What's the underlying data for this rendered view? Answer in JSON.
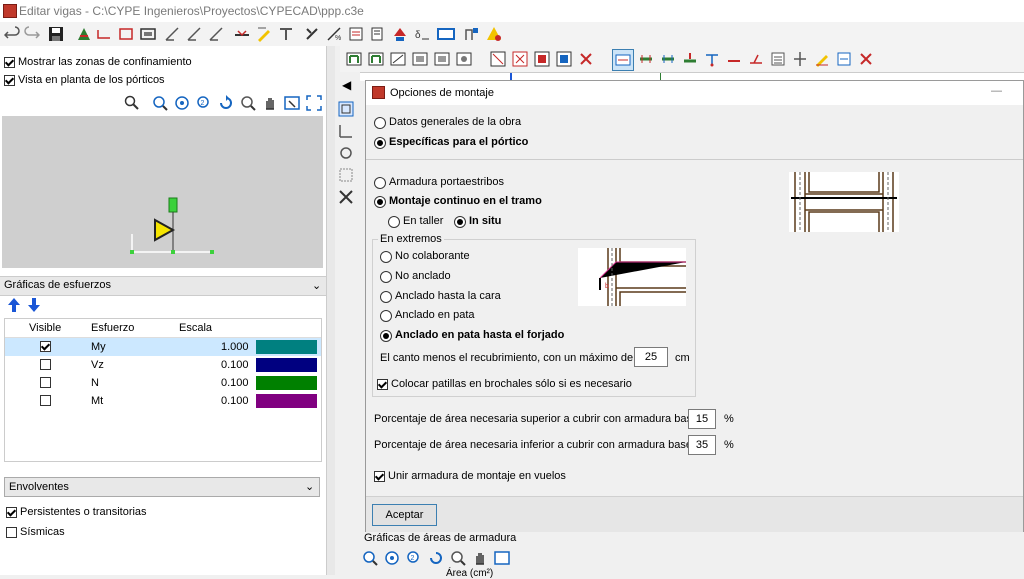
{
  "window": {
    "title": "Editar vigas - C:\\CYPE Ingenieros\\Proyectos\\CYPECAD\\ppp.c3e"
  },
  "left": {
    "show_confinement": {
      "label": "Mostrar las zonas de confinamiento",
      "checked": true
    },
    "plan_view": {
      "label": "Vista en planta de los pórticos",
      "checked": true
    },
    "graphs_header": "Gráficas de esfuerzos",
    "table": {
      "columns": [
        "Visible",
        "Esfuerzo",
        "Escala"
      ],
      "rows": [
        {
          "visible": true,
          "name": "My",
          "scale": "1.000",
          "color": "#008080"
        },
        {
          "visible": false,
          "name": "Vz",
          "scale": "0.100",
          "color": "#000080"
        },
        {
          "visible": false,
          "name": "N",
          "scale": "0.100",
          "color": "#008000"
        },
        {
          "visible": false,
          "name": "Mt",
          "scale": "0.100",
          "color": "#800080"
        }
      ]
    },
    "envelope_select": "Envolventes",
    "persistent": {
      "label": "Persistentes o transitorias",
      "checked": true
    },
    "seismic": {
      "label": "Sísmicas",
      "checked": false
    }
  },
  "dialog": {
    "title": "Opciones de montaje",
    "scope": {
      "general": "Datos generales de la obra",
      "specific": "Específicas para el pórtico",
      "selected": "specific"
    },
    "armature": {
      "option1": "Armadura portaestribos",
      "option2": "Montaje continuo en el tramo",
      "selected": "option2",
      "sub_taller": "En taller",
      "sub_situ": "In situ",
      "sub_selected": "situ"
    },
    "extremes": {
      "group_label": "En extremos",
      "options": [
        "No colaborante",
        "No anclado",
        "Anclado hasta la cara",
        "Anclado en pata",
        "Anclado en pata hasta el forjado"
      ],
      "selected_index": 4,
      "canto_label": "El canto menos el recubrimiento, con un máximo de",
      "canto_value": "25",
      "canto_unit": "cm",
      "patillas_label": "Colocar patillas en brochales sólo si es necesario",
      "patillas_checked": true
    },
    "sup_label": "Porcentaje de área necesaria superior a cubrir con armadura base",
    "sup_value": "15",
    "inf_label": "Porcentaje de área necesaria inferior a cubrir con armadura base",
    "inf_value": "35",
    "percent_unit": "%",
    "unir_label": "Unir armadura de montaje en vuelos",
    "unir_checked": true,
    "accept": "Aceptar"
  },
  "bottom": {
    "graphs_areas": "Gráficas de áreas de armadura",
    "partial_header": "Área (cm²)"
  },
  "icons": [
    "undo-icon",
    "redo-icon",
    "save-icon",
    "zoom-icon",
    "pan-icon",
    "zoom-window-icon",
    "fit-icon"
  ]
}
